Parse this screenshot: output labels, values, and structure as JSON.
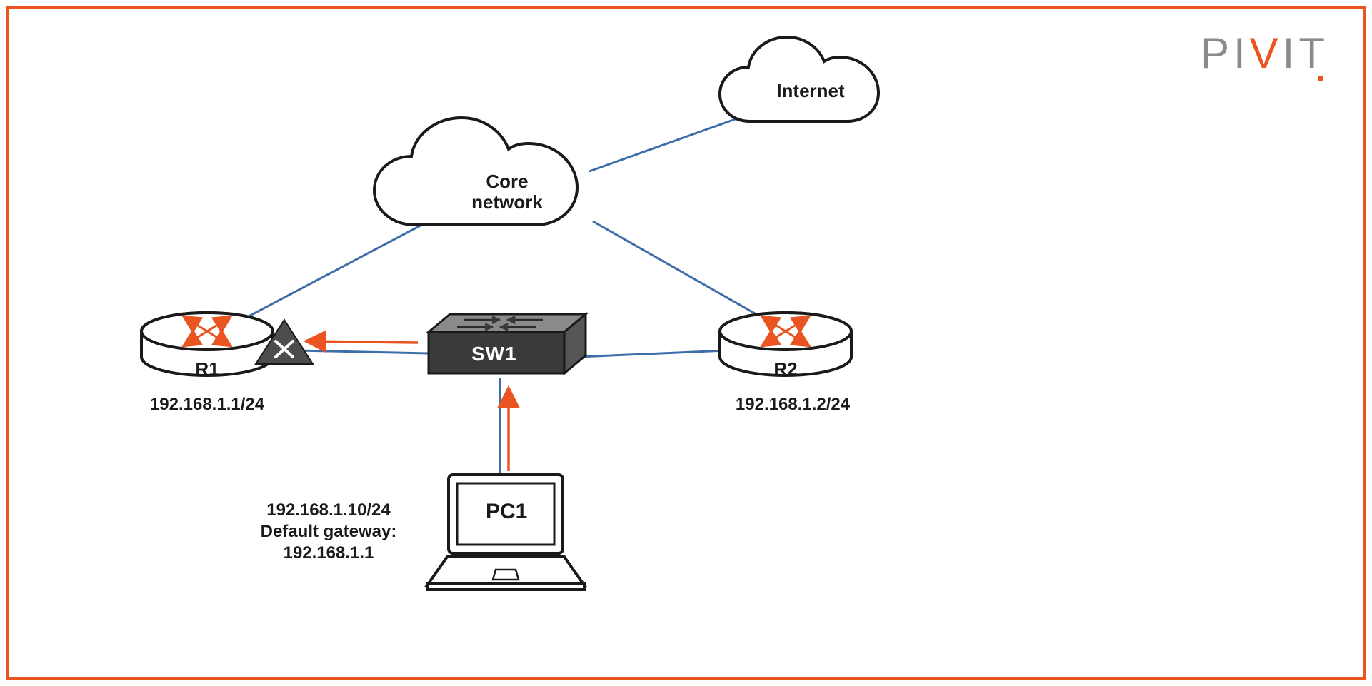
{
  "brand": {
    "p1": "PI",
    "v": "V",
    "p2": "IT"
  },
  "clouds": {
    "internet": "Internet",
    "core1": "Core",
    "core2": "network"
  },
  "routers": {
    "r1": {
      "name": "R1",
      "ip": "192.168.1.1/24"
    },
    "r2": {
      "name": "R2",
      "ip": "192.168.1.2/24"
    }
  },
  "switch": {
    "name": "SW1"
  },
  "pc": {
    "name": "PC1",
    "ip": "192.168.1.10/24",
    "gw_label": "Default gateway:",
    "gw_ip": "192.168.1.1"
  }
}
